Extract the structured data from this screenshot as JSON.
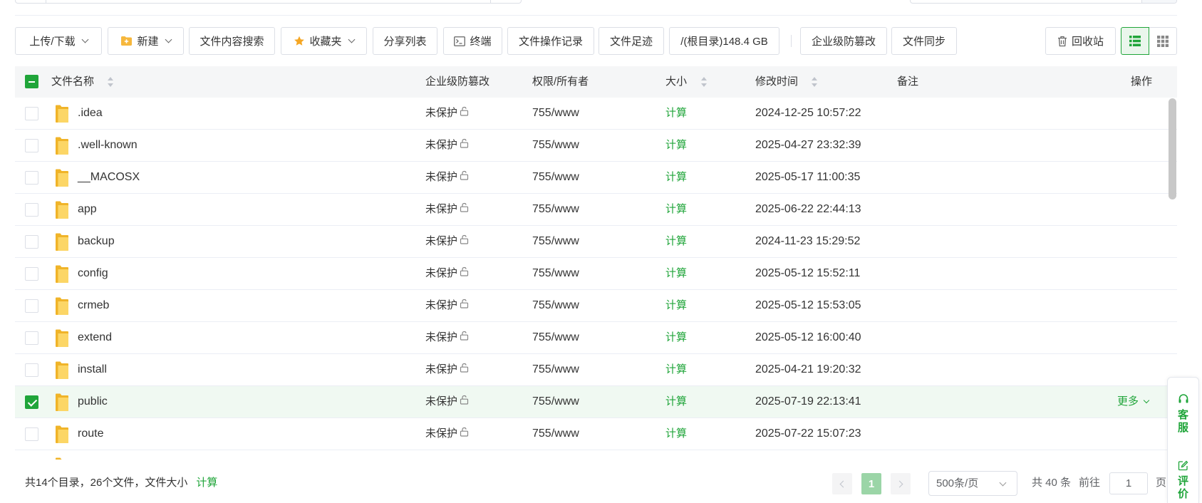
{
  "toolbar": {
    "upload_download": "上传/下载",
    "new": "新建",
    "content_search": "文件内容搜索",
    "favorites": "收藏夹",
    "share_list": "分享列表",
    "terminal": "终端",
    "operation_log": "文件操作记录",
    "footprint": "文件足迹",
    "disk_usage": "/(根目录)148.4 GB",
    "tamper_proof": "企业级防篡改",
    "file_sync": "文件同步",
    "recycle_bin": "回收站",
    "list_view_active": true
  },
  "table": {
    "columns": {
      "name": "文件名称",
      "tamper": "企业级防篡改",
      "permission": "权限/所有者",
      "size": "大小",
      "modified": "修改时间",
      "note": "备注",
      "action": "操作"
    },
    "select_all_partial": true,
    "rows": [
      {
        "name": ".idea",
        "tamper": "未保护",
        "permission": "755/www",
        "size": "计算",
        "modified": "2024-12-25 10:57:22",
        "checked": false
      },
      {
        "name": ".well-known",
        "tamper": "未保护",
        "permission": "755/www",
        "size": "计算",
        "modified": "2025-04-27 23:32:39",
        "checked": false
      },
      {
        "name": "__MACOSX",
        "tamper": "未保护",
        "permission": "755/www",
        "size": "计算",
        "modified": "2025-05-17 11:00:35",
        "checked": false
      },
      {
        "name": "app",
        "tamper": "未保护",
        "permission": "755/www",
        "size": "计算",
        "modified": "2025-06-22 22:44:13",
        "checked": false
      },
      {
        "name": "backup",
        "tamper": "未保护",
        "permission": "755/www",
        "size": "计算",
        "modified": "2024-11-23 15:29:52",
        "checked": false
      },
      {
        "name": "config",
        "tamper": "未保护",
        "permission": "755/www",
        "size": "计算",
        "modified": "2025-05-12 15:52:11",
        "checked": false
      },
      {
        "name": "crmeb",
        "tamper": "未保护",
        "permission": "755/www",
        "size": "计算",
        "modified": "2025-05-12 15:53:05",
        "checked": false
      },
      {
        "name": "extend",
        "tamper": "未保护",
        "permission": "755/www",
        "size": "计算",
        "modified": "2025-05-12 16:00:40",
        "checked": false
      },
      {
        "name": "install",
        "tamper": "未保护",
        "permission": "755/www",
        "size": "计算",
        "modified": "2025-04-21 19:20:32",
        "checked": false
      },
      {
        "name": "public",
        "tamper": "未保护",
        "permission": "755/www",
        "size": "计算",
        "modified": "2025-07-19 22:13:41",
        "checked": true,
        "action": "更多"
      },
      {
        "name": "route",
        "tamper": "未保护",
        "permission": "755/www",
        "size": "计算",
        "modified": "2025-07-22 15:07:23",
        "checked": false
      }
    ]
  },
  "footer": {
    "summary": "共14个目录，26个文件，文件大小",
    "summary_link": "计算",
    "current_page": "1",
    "page_size": "500条/页",
    "total": "共 40 条",
    "goto_label": "前往",
    "goto_value": "1",
    "page_suffix": "页"
  },
  "float_widget": {
    "service": "客服",
    "review": "评价"
  },
  "icons": {
    "new": "folder-plus-icon",
    "favorites": "star-icon",
    "terminal": "terminal-icon",
    "recycle_bin": "trash-icon",
    "list_view": "list-view-icon",
    "grid_view": "grid-view-icon",
    "row_type": "folder-icon",
    "tamper_status": "unlock-icon",
    "service": "headset-icon",
    "review": "edit-icon"
  },
  "colors": {
    "accent": "#20a53a",
    "selected_row": "#f0f9f2",
    "folder": "#fcd666",
    "star": "#f5a623"
  }
}
